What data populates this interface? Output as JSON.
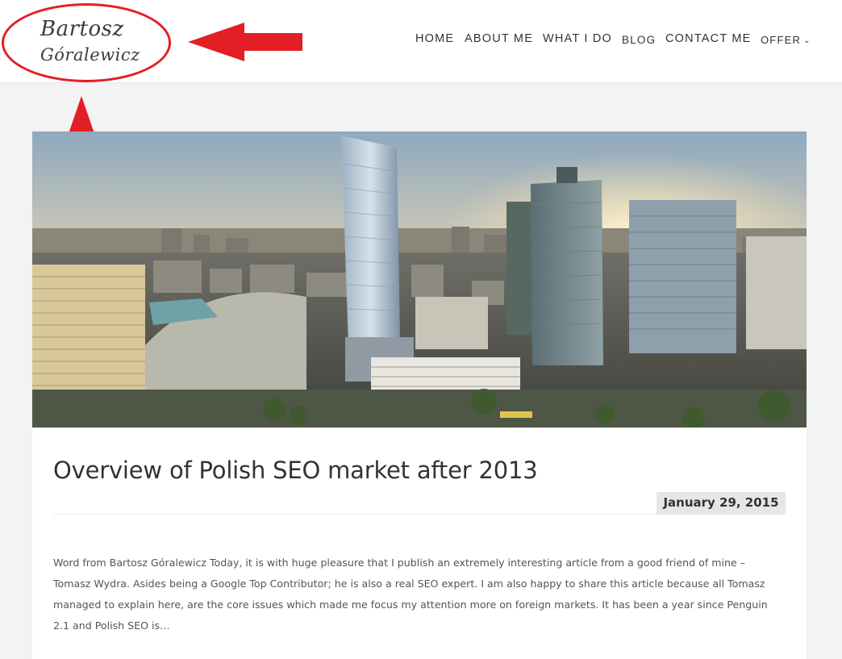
{
  "logo": {
    "line1": "Bartosz",
    "line2": "Góralewicz"
  },
  "nav": {
    "home": "HOME",
    "about": "ABOUT ME",
    "what": "WHAT I DO",
    "blog": "BLOG",
    "contact": "CONTACT ME",
    "offer": "OFFER"
  },
  "post": {
    "title": "Overview of Polish SEO market after 2013",
    "date": "January 29, 2015",
    "excerpt": "Word from Bartosz Góralewicz Today, it is with huge pleasure that I publish an extremely interesting article from a good friend of mine – Tomasz Wydra. Asides being a Google Top Contributor; he is also a real SEO expert. I am also happy to share this article because all Tomasz managed to explain here, are the core issues which made me focus my attention more on foreign markets. It has been a year since Penguin 2.1 and Polish SEO is…"
  },
  "colors": {
    "annotation": "#e31e24",
    "header_bg": "#ffffff",
    "page_bg": "#f3f3f3",
    "date_badge_bg": "#e6e6e6"
  },
  "icons": {
    "offer_chevron": "chevron-down-icon"
  }
}
